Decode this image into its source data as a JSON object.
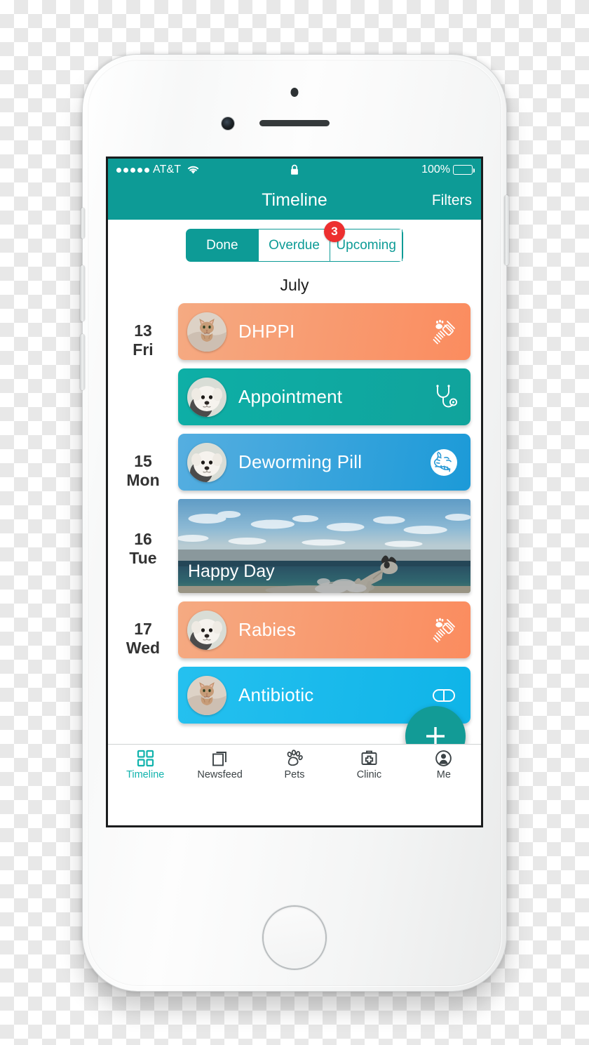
{
  "device": {
    "name": "white-iphone",
    "hardware": [
      "front-camera",
      "earpiece-speaker",
      "proximity-sensor",
      "home-button",
      "volume-up",
      "volume-down",
      "mute-switch",
      "power-button"
    ]
  },
  "status_bar": {
    "signal_dots": 5,
    "carrier": "AT&T",
    "wifi_icon": "wifi-icon",
    "lock_icon": "lock-icon",
    "battery_percent": "100%",
    "battery_level": 100
  },
  "nav_bar": {
    "title": "Timeline",
    "right_button": "Filters"
  },
  "segmented_control": {
    "options": [
      {
        "label": "Done",
        "selected": true
      },
      {
        "label": "Overdue",
        "selected": false
      },
      {
        "label": "Upcoming",
        "selected": false
      }
    ],
    "badge": "3",
    "badge_color": "#ed2f2f",
    "accent_color": "#0d9b96"
  },
  "month_label": "July",
  "timeline": [
    {
      "date_day": "13",
      "date_weekday": "Fri",
      "cards": [
        {
          "title": "DHPPI",
          "type": "vaccine",
          "icon": "syringe-paw-icon",
          "avatar": "cat-avatar",
          "color": "#f79d74"
        },
        {
          "title": "Appointment",
          "type": "appointment",
          "icon": "stethoscope-icon",
          "avatar": "dog-avatar",
          "color": "#10a79f"
        }
      ]
    },
    {
      "date_day": "15",
      "date_weekday": "Mon",
      "cards": [
        {
          "title": "Deworming Pill",
          "type": "deworming",
          "icon": "deworming-icon",
          "avatar": "dog-avatar",
          "color": "#2fa2dc"
        }
      ]
    },
    {
      "date_day": "16",
      "date_weekday": "Tue",
      "cards": [
        {
          "title": "Happy Day",
          "type": "photo",
          "icon": "",
          "avatar": "",
          "color": ""
        }
      ]
    },
    {
      "date_day": "17",
      "date_weekday": "Wed",
      "cards": [
        {
          "title": "Rabies",
          "type": "vaccine",
          "icon": "syringe-paw-icon",
          "avatar": "dog-avatar",
          "color": "#f79d74"
        },
        {
          "title": "Antibiotic",
          "type": "antibiotic",
          "icon": "pill-icon",
          "avatar": "cat-avatar",
          "color": "#18bbec"
        }
      ]
    }
  ],
  "fab": {
    "icon": "plus-icon",
    "color": "#129b96"
  },
  "tab_bar": {
    "active_color": "#12b3ad",
    "items": [
      {
        "label": "Timeline",
        "icon": "grid-icon",
        "active": true
      },
      {
        "label": "Newsfeed",
        "icon": "cards-icon",
        "active": false
      },
      {
        "label": "Pets",
        "icon": "paw-icon",
        "active": false
      },
      {
        "label": "Clinic",
        "icon": "medical-bag-icon",
        "active": false
      },
      {
        "label": "Me",
        "icon": "person-icon",
        "active": false
      }
    ]
  }
}
